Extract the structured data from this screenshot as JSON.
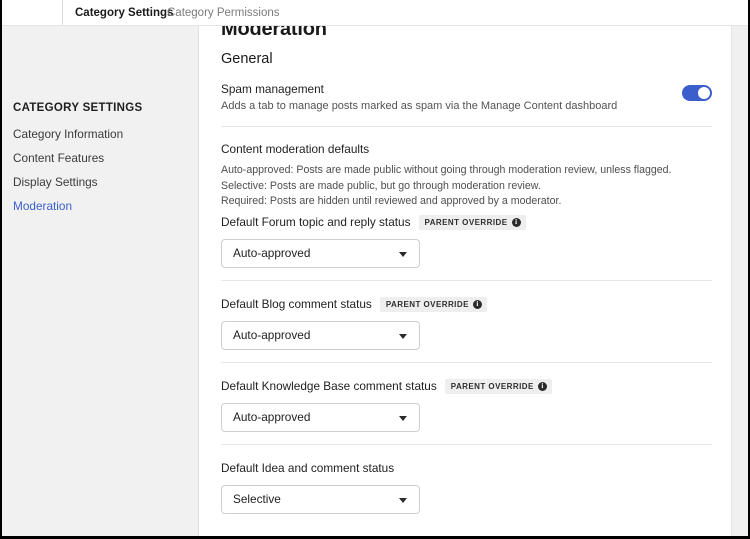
{
  "tabs": [
    {
      "label": "Category Settings",
      "active": true
    },
    {
      "label": "Category Permissions",
      "active": false
    }
  ],
  "sidebar": {
    "title": "CATEGORY SETTINGS",
    "items": [
      {
        "label": "Category Information"
      },
      {
        "label": "Content Features"
      },
      {
        "label": "Display Settings"
      },
      {
        "label": "Moderation"
      }
    ]
  },
  "main": {
    "page_title": "Moderation",
    "section_title": "General",
    "spam": {
      "label": "Spam management",
      "description": "Adds a tab to manage posts marked as spam via the Manage Content dashboard",
      "toggle_on": true,
      "toggle_color": "#3c5ecc"
    },
    "defaults": {
      "heading": "Content moderation defaults",
      "lines": [
        "Auto-approved: Posts are made public without going through moderation review, unless flagged.",
        "Selective: Posts are made public, but go through moderation review.",
        "Required: Posts are hidden until reviewed and approved by a moderator."
      ]
    },
    "fields": [
      {
        "label": "Default Forum topic and reply status",
        "badge": "PARENT OVERRIDE",
        "has_badge": true,
        "value": "Auto-approved"
      },
      {
        "label": "Default Blog comment status",
        "badge": "PARENT OVERRIDE",
        "has_badge": true,
        "value": "Auto-approved"
      },
      {
        "label": "Default Knowledge Base comment status",
        "badge": "PARENT OVERRIDE",
        "has_badge": true,
        "value": "Auto-approved"
      },
      {
        "label": "Default Idea and comment status",
        "badge": "",
        "has_badge": false,
        "value": "Selective"
      }
    ]
  }
}
